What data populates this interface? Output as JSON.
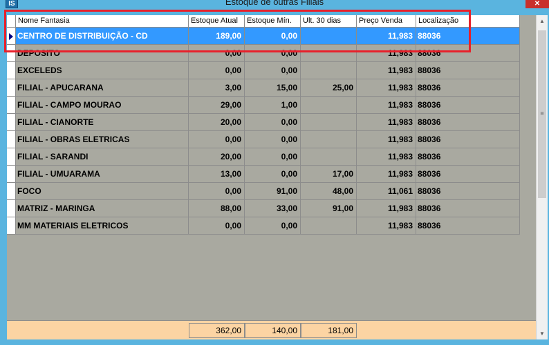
{
  "window": {
    "title": "Estoque de outras Filiais",
    "app_icon_text": "IS",
    "close_glyph": "✕"
  },
  "columns": [
    {
      "key": "nome",
      "label": "Nome Fantasia",
      "align": "l"
    },
    {
      "key": "atual",
      "label": "Estoque Atual",
      "align": "r"
    },
    {
      "key": "min",
      "label": "Estoque Mín.",
      "align": "r"
    },
    {
      "key": "ult30",
      "label": "Ult. 30 dias",
      "align": "r"
    },
    {
      "key": "preco",
      "label": "Preço Venda",
      "align": "r"
    },
    {
      "key": "loc",
      "label": "Localização",
      "align": "l"
    }
  ],
  "rows": [
    {
      "nome": "CENTRO DE DISTRIBUIÇÃO - CD",
      "atual": "189,00",
      "min": "0,00",
      "ult30": "",
      "preco": "11,983",
      "loc": "88036",
      "selected": true
    },
    {
      "nome": "DEPOSITO",
      "atual": "0,00",
      "min": "0,00",
      "ult30": "",
      "preco": "11,983",
      "loc": "88036"
    },
    {
      "nome": "EXCELEDS",
      "atual": "0,00",
      "min": "0,00",
      "ult30": "",
      "preco": "11,983",
      "loc": "88036"
    },
    {
      "nome": "FILIAL - APUCARANA",
      "atual": "3,00",
      "min": "15,00",
      "ult30": "25,00",
      "preco": "11,983",
      "loc": "88036"
    },
    {
      "nome": "FILIAL - CAMPO MOURAO",
      "atual": "29,00",
      "min": "1,00",
      "ult30": "",
      "preco": "11,983",
      "loc": "88036"
    },
    {
      "nome": "FILIAL - CIANORTE",
      "atual": "20,00",
      "min": "0,00",
      "ult30": "",
      "preco": "11,983",
      "loc": "88036"
    },
    {
      "nome": "FILIAL - OBRAS ELETRICAS",
      "atual": "0,00",
      "min": "0,00",
      "ult30": "",
      "preco": "11,983",
      "loc": "88036"
    },
    {
      "nome": "FILIAL - SARANDI",
      "atual": "20,00",
      "min": "0,00",
      "ult30": "",
      "preco": "11,983",
      "loc": "88036"
    },
    {
      "nome": "FILIAL - UMUARAMA",
      "atual": "13,00",
      "min": "0,00",
      "ult30": "17,00",
      "preco": "11,983",
      "loc": "88036"
    },
    {
      "nome": "FOCO",
      "atual": "0,00",
      "min": "91,00",
      "ult30": "48,00",
      "preco": "11,061",
      "loc": "88036"
    },
    {
      "nome": "MATRIZ - MARINGA",
      "atual": "88,00",
      "min": "33,00",
      "ult30": "91,00",
      "preco": "11,983",
      "loc": "88036"
    },
    {
      "nome": "MM MATERIAIS ELETRICOS",
      "atual": "0,00",
      "min": "0,00",
      "ult30": "",
      "preco": "11,983",
      "loc": "88036"
    }
  ],
  "totals": {
    "atual": "362,00",
    "min": "140,00",
    "ult30": "181,00"
  },
  "scrollbar": {
    "up_glyph": "▲",
    "down_glyph": "▼",
    "grip_glyph": "≡"
  },
  "colors": {
    "selection": "#3399ff",
    "grid_bg": "#a9a9a0",
    "footer_bg": "#fcd4a3",
    "highlight": "#e8202a"
  }
}
